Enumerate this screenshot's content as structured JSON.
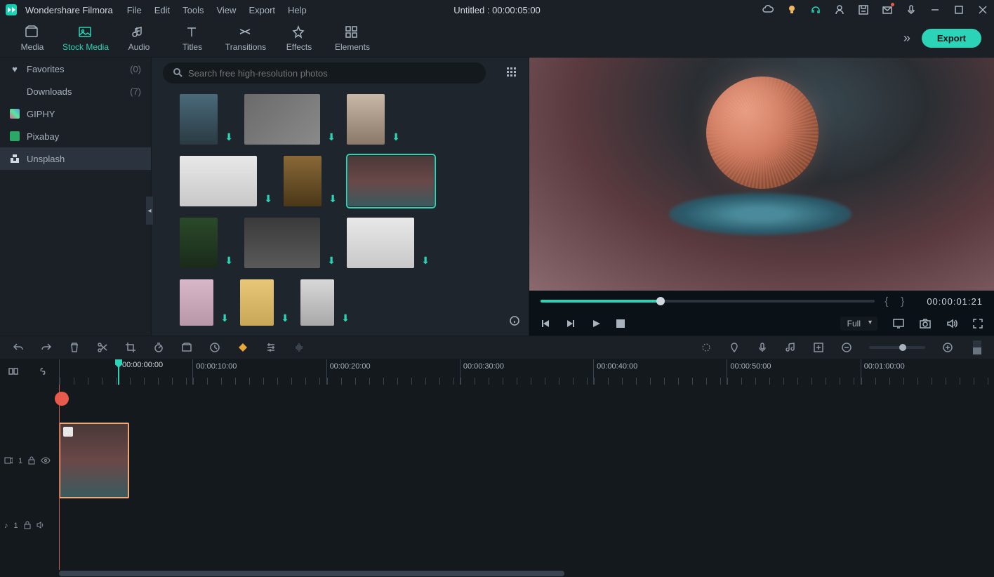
{
  "app": {
    "name": "Wondershare Filmora"
  },
  "menu": [
    "File",
    "Edit",
    "Tools",
    "View",
    "Export",
    "Help"
  ],
  "document_title": "Untitled : 00:00:05:00",
  "tabs": [
    {
      "label": "Media"
    },
    {
      "label": "Stock Media"
    },
    {
      "label": "Audio"
    },
    {
      "label": "Titles"
    },
    {
      "label": "Transitions"
    },
    {
      "label": "Effects"
    },
    {
      "label": "Elements"
    }
  ],
  "active_tab": 1,
  "export_label": "Export",
  "sidebar": [
    {
      "label": "Favorites",
      "count": "(0)",
      "icon": "heart"
    },
    {
      "label": "Downloads",
      "count": "(7)",
      "icon": ""
    },
    {
      "label": "GIPHY",
      "count": "",
      "icon": "giphy"
    },
    {
      "label": "Pixabay",
      "count": "",
      "icon": "pixabay"
    },
    {
      "label": "Unsplash",
      "count": "",
      "icon": "unsplash"
    }
  ],
  "active_sidebar": 4,
  "search_placeholder": "Search free high-resolution photos",
  "preview": {
    "timecode": "00:00:01:21",
    "quality": "Full"
  },
  "ruler": [
    "00:00:00:00",
    "00:00:10:00",
    "00:00:20:00",
    "00:00:30:00",
    "00:00:40:00",
    "00:00:50:00",
    "00:01:00:00"
  ],
  "playhead_tc": "00:00:00:00",
  "tracks": {
    "video_label": "1",
    "audio_label": "1"
  }
}
